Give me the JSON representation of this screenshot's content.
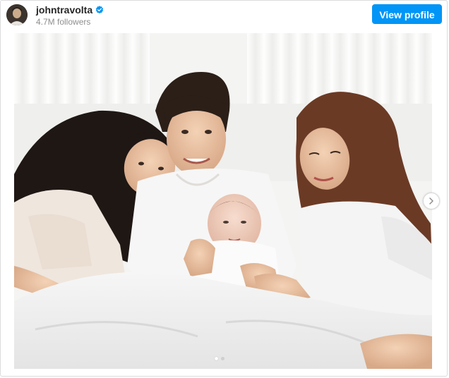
{
  "profile": {
    "username": "johntravolta",
    "followers": "4.7M followers",
    "view_profile_label": "View profile",
    "verified": true
  },
  "post": {
    "image_icon": "photo",
    "carousel": {
      "slide_count": 2,
      "active_index": 0
    }
  },
  "colors": {
    "accent": "#0095f6",
    "verified_badge": "#0095f6"
  }
}
